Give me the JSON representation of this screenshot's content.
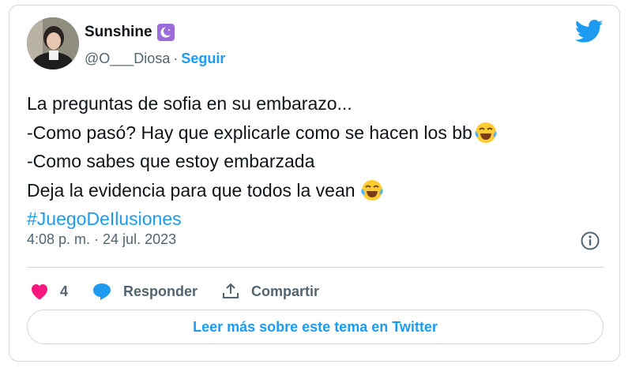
{
  "author": {
    "display_name": "Sunshine",
    "badge_icon": "crescent-moon-icon",
    "handle": "@O___Diosa",
    "separator": "·",
    "follow_label": "Seguir"
  },
  "tweet": {
    "lines": [
      "La preguntas de sofia en su embarazo...",
      "-Como pasó? Hay que explicarle como se hacen los bb",
      "-Como sabes que estoy embarzada",
      "Deja la evidencia para que todos la vean "
    ],
    "hashtag": "#JuegoDeIlusiones",
    "emoji": "face-with-tears-of-joy-icon"
  },
  "meta": {
    "timestamp": "4:08 p. m. · 24 jul. 2023"
  },
  "actions": {
    "like_count": "4",
    "reply_label": "Responder",
    "share_label": "Compartir"
  },
  "footer": {
    "read_more_label": "Leer más sobre este tema en Twitter"
  },
  "colors": {
    "accent": "#1d9bf0",
    "heart": "#f91880",
    "text": "#0f1419",
    "secondary": "#536471",
    "border": "#cfd9de",
    "badge": "#9b6ddc"
  }
}
